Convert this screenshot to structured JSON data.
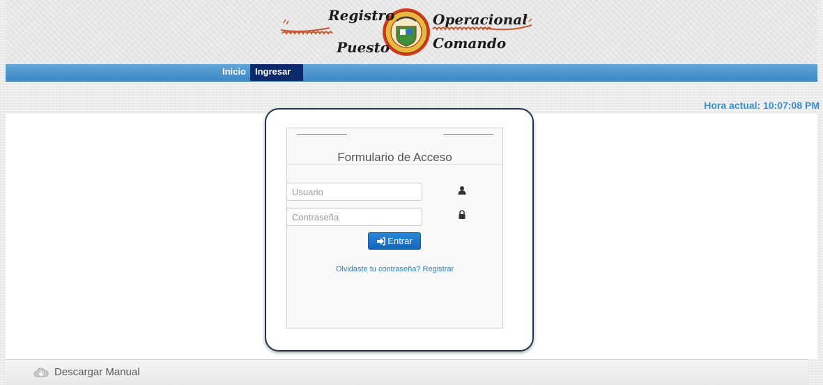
{
  "header": {
    "logo_words": {
      "top_left": "Registro",
      "top_right": "Operacional",
      "bottom_left": "Puesto",
      "bottom_right": "Comando"
    }
  },
  "nav": {
    "items": [
      {
        "label": "Inicio"
      },
      {
        "label": "Ingresar"
      }
    ]
  },
  "clock": {
    "text": "Hora actual: 10:07:08 PM"
  },
  "login": {
    "title": "Formulario de Acceso",
    "username_placeholder": "Usuario",
    "password_placeholder": "Contraseña",
    "submit_label": "Entrar",
    "forgot_link": "Olvidaste tu contraseña? Registrar"
  },
  "download": {
    "label": "Descargar Manual"
  },
  "icons": {
    "user": "user-icon",
    "lock": "lock-icon",
    "sign-in": "sign-in-icon",
    "download": "cloud-download-icon"
  },
  "colors": {
    "nav_bar": "#3c88c6",
    "nav_active": "#0b2a6b",
    "clock": "#3a8ed4",
    "button": "#1f74c6",
    "link": "#2a7fc8",
    "frame_border": "#1e3553"
  }
}
